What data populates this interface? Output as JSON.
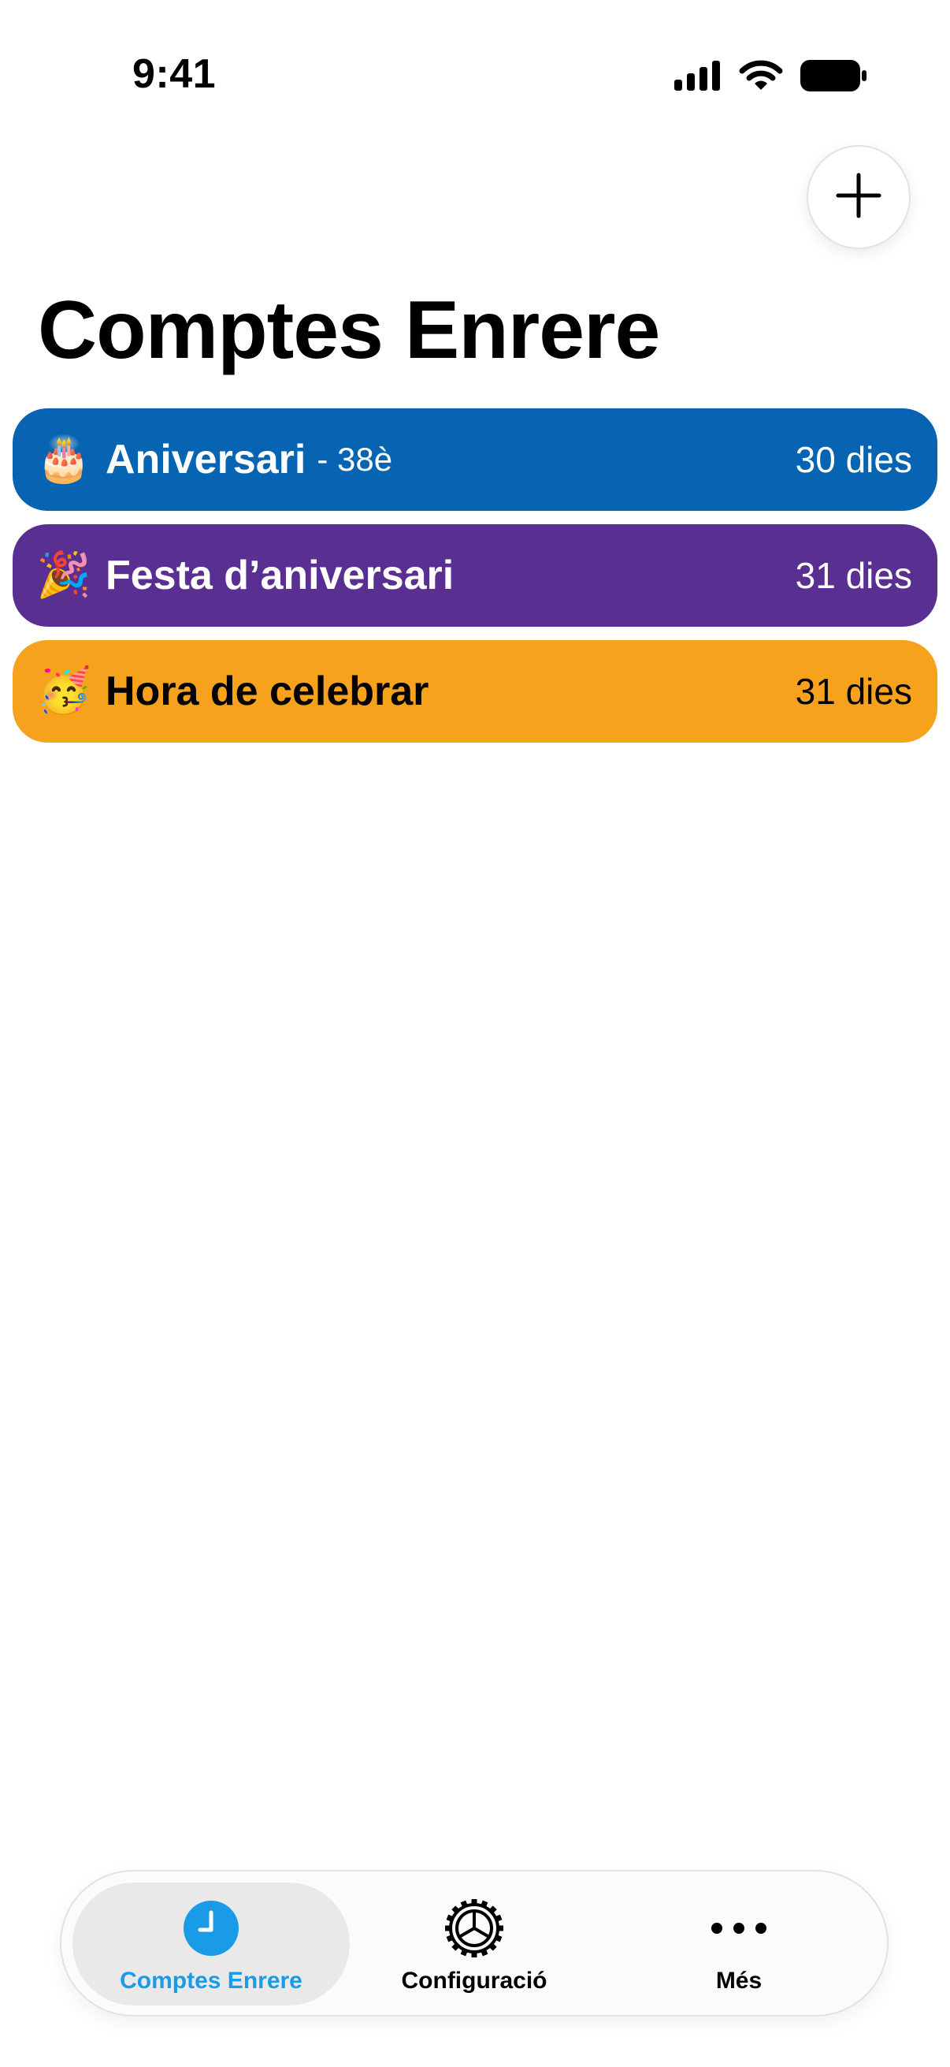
{
  "status_bar": {
    "time": "9:41"
  },
  "header": {
    "title": "Comptes Enrere",
    "add_button_icon": "plus-icon"
  },
  "events": [
    {
      "emoji": "🎂",
      "title": "Aniversari",
      "subtitle": "- 38è",
      "count": "30 dies",
      "color": "#0664b2",
      "text_color": "#ffffff"
    },
    {
      "emoji": "🎉",
      "title": "Festa d’aniversari",
      "subtitle": "",
      "count": "31 dies",
      "color": "#5a2f92",
      "text_color": "#ffffff"
    },
    {
      "emoji": "🥳",
      "title": "Hora de celebrar",
      "subtitle": "",
      "count": "31 dies",
      "color": "#f7a21d",
      "text_color": "#000000"
    }
  ],
  "tab_bar": {
    "tabs": [
      {
        "label": "Comptes Enrere",
        "icon": "clock-icon",
        "active": true
      },
      {
        "label": "Configuració",
        "icon": "gear-icon",
        "active": false
      },
      {
        "label": "Més",
        "icon": "more-icon",
        "active": false
      }
    ],
    "accent_color": "#1a9be8"
  }
}
